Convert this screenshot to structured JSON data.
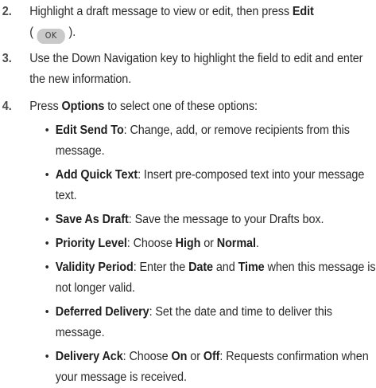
{
  "steps": [
    {
      "number": "2.",
      "text_before": "Highlight a draft message to view or edit, then press ",
      "bold": "Edit",
      "paren_open": "(",
      "key_label": "OK",
      "paren_close": ")."
    },
    {
      "number": "3.",
      "text": "Use the Down Navigation key to highlight the field to edit and enter the new information."
    },
    {
      "number": "4.",
      "text_before": "Press ",
      "bold": "Options",
      "text_after": " to select one of these options:"
    }
  ],
  "options": [
    {
      "name": "Edit Send To",
      "desc": ": Change, add, or remove recipients from this message."
    },
    {
      "name": "Add Quick Text",
      "desc": ": Insert pre-composed text into your message text."
    },
    {
      "name": "Save As Draft",
      "desc": ": Save the message to your Drafts box."
    },
    {
      "name": "Priority Level",
      "desc1": ": Choose ",
      "b1": "High",
      "mid": " or ",
      "b2": "Normal",
      "end": "."
    },
    {
      "name": "Validity Period",
      "desc1": ": Enter the ",
      "b1": "Date",
      "mid": " and ",
      "b2": "Time",
      "end": " when this message is not longer valid."
    },
    {
      "name": "Deferred Delivery",
      "desc": ": Set the date and time to deliver this message."
    },
    {
      "name": "Delivery Ack",
      "desc1": ": Choose ",
      "b1": "On",
      "mid": " or ",
      "b2": "Off",
      "end": ": Requests confirmation when your message is received."
    }
  ],
  "bullet_char": "•"
}
